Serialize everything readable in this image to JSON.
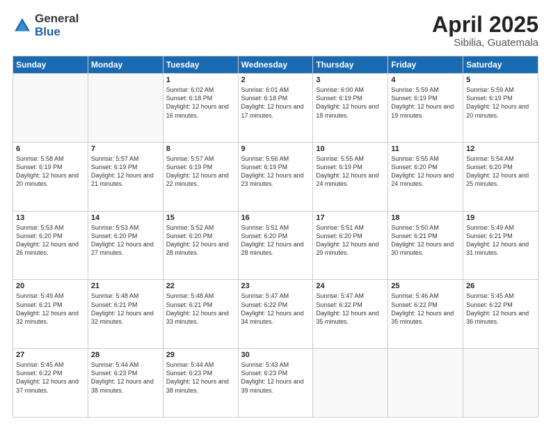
{
  "logo": {
    "general": "General",
    "blue": "Blue"
  },
  "title": {
    "month_year": "April 2025",
    "location": "Sibilia, Guatemala"
  },
  "days_of_week": [
    "Sunday",
    "Monday",
    "Tuesday",
    "Wednesday",
    "Thursday",
    "Friday",
    "Saturday"
  ],
  "weeks": [
    [
      {
        "day": "",
        "info": ""
      },
      {
        "day": "",
        "info": ""
      },
      {
        "day": "1",
        "info": "Sunrise: 6:02 AM\nSunset: 6:18 PM\nDaylight: 12 hours and 16 minutes."
      },
      {
        "day": "2",
        "info": "Sunrise: 6:01 AM\nSunset: 6:18 PM\nDaylight: 12 hours and 17 minutes."
      },
      {
        "day": "3",
        "info": "Sunrise: 6:00 AM\nSunset: 6:19 PM\nDaylight: 12 hours and 18 minutes."
      },
      {
        "day": "4",
        "info": "Sunrise: 5:59 AM\nSunset: 6:19 PM\nDaylight: 12 hours and 19 minutes."
      },
      {
        "day": "5",
        "info": "Sunrise: 5:59 AM\nSunset: 6:19 PM\nDaylight: 12 hours and 20 minutes."
      }
    ],
    [
      {
        "day": "6",
        "info": "Sunrise: 5:58 AM\nSunset: 6:19 PM\nDaylight: 12 hours and 20 minutes."
      },
      {
        "day": "7",
        "info": "Sunrise: 5:57 AM\nSunset: 6:19 PM\nDaylight: 12 hours and 21 minutes."
      },
      {
        "day": "8",
        "info": "Sunrise: 5:57 AM\nSunset: 6:19 PM\nDaylight: 12 hours and 22 minutes."
      },
      {
        "day": "9",
        "info": "Sunrise: 5:56 AM\nSunset: 6:19 PM\nDaylight: 12 hours and 23 minutes."
      },
      {
        "day": "10",
        "info": "Sunrise: 5:55 AM\nSunset: 6:19 PM\nDaylight: 12 hours and 24 minutes."
      },
      {
        "day": "11",
        "info": "Sunrise: 5:55 AM\nSunset: 6:20 PM\nDaylight: 12 hours and 24 minutes."
      },
      {
        "day": "12",
        "info": "Sunrise: 5:54 AM\nSunset: 6:20 PM\nDaylight: 12 hours and 25 minutes."
      }
    ],
    [
      {
        "day": "13",
        "info": "Sunrise: 5:53 AM\nSunset: 6:20 PM\nDaylight: 12 hours and 26 minutes."
      },
      {
        "day": "14",
        "info": "Sunrise: 5:53 AM\nSunset: 6:20 PM\nDaylight: 12 hours and 27 minutes."
      },
      {
        "day": "15",
        "info": "Sunrise: 5:52 AM\nSunset: 6:20 PM\nDaylight: 12 hours and 28 minutes."
      },
      {
        "day": "16",
        "info": "Sunrise: 5:51 AM\nSunset: 6:20 PM\nDaylight: 12 hours and 28 minutes."
      },
      {
        "day": "17",
        "info": "Sunrise: 5:51 AM\nSunset: 6:20 PM\nDaylight: 12 hours and 29 minutes."
      },
      {
        "day": "18",
        "info": "Sunrise: 5:50 AM\nSunset: 6:21 PM\nDaylight: 12 hours and 30 minutes."
      },
      {
        "day": "19",
        "info": "Sunrise: 5:49 AM\nSunset: 6:21 PM\nDaylight: 12 hours and 31 minutes."
      }
    ],
    [
      {
        "day": "20",
        "info": "Sunrise: 5:49 AM\nSunset: 6:21 PM\nDaylight: 12 hours and 32 minutes."
      },
      {
        "day": "21",
        "info": "Sunrise: 5:48 AM\nSunset: 6:21 PM\nDaylight: 12 hours and 32 minutes."
      },
      {
        "day": "22",
        "info": "Sunrise: 5:48 AM\nSunset: 6:21 PM\nDaylight: 12 hours and 33 minutes."
      },
      {
        "day": "23",
        "info": "Sunrise: 5:47 AM\nSunset: 6:22 PM\nDaylight: 12 hours and 34 minutes."
      },
      {
        "day": "24",
        "info": "Sunrise: 5:47 AM\nSunset: 6:22 PM\nDaylight: 12 hours and 35 minutes."
      },
      {
        "day": "25",
        "info": "Sunrise: 5:46 AM\nSunset: 6:22 PM\nDaylight: 12 hours and 35 minutes."
      },
      {
        "day": "26",
        "info": "Sunrise: 5:45 AM\nSunset: 6:22 PM\nDaylight: 12 hours and 36 minutes."
      }
    ],
    [
      {
        "day": "27",
        "info": "Sunrise: 5:45 AM\nSunset: 6:22 PM\nDaylight: 12 hours and 37 minutes."
      },
      {
        "day": "28",
        "info": "Sunrise: 5:44 AM\nSunset: 6:23 PM\nDaylight: 12 hours and 38 minutes."
      },
      {
        "day": "29",
        "info": "Sunrise: 5:44 AM\nSunset: 6:23 PM\nDaylight: 12 hours and 38 minutes."
      },
      {
        "day": "30",
        "info": "Sunrise: 5:43 AM\nSunset: 6:23 PM\nDaylight: 12 hours and 39 minutes."
      },
      {
        "day": "",
        "info": ""
      },
      {
        "day": "",
        "info": ""
      },
      {
        "day": "",
        "info": ""
      }
    ]
  ]
}
